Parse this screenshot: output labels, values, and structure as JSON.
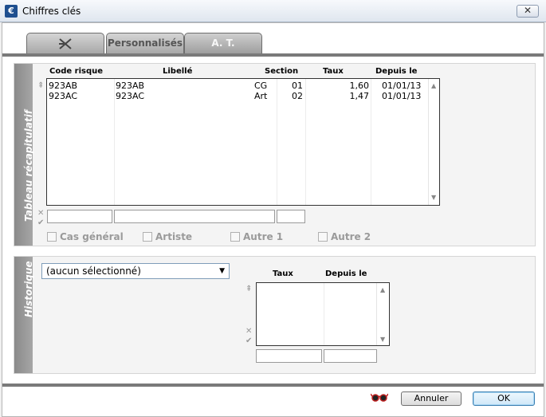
{
  "window": {
    "title": "Chiffres clés",
    "close_glyph": "✕",
    "app_icon_glyph": "€"
  },
  "tabs": [
    {
      "label": "",
      "icon": "cross-tools-icon"
    },
    {
      "label": "Personnalisés"
    },
    {
      "label": "A. T."
    }
  ],
  "summary": {
    "section_label": "Tableau récapitulatif",
    "headers": {
      "code": "Code risque",
      "libelle": "Libellé",
      "section": "Section",
      "taux": "Taux",
      "depuis": "Depuis le"
    },
    "rows": [
      {
        "code": "923AB",
        "libelle": "923AB",
        "section_a": "CG",
        "section_b": "01",
        "taux": "1,60",
        "depuis": "01/01/13"
      },
      {
        "code": "923AC",
        "libelle": "923AC",
        "section_a": "Art",
        "section_b": "02",
        "taux": "1,47",
        "depuis": "01/01/13"
      }
    ],
    "checkboxes": [
      "Cas général",
      "Artiste",
      "Autre 1",
      "Autre 2"
    ]
  },
  "history": {
    "section_label": "Historique",
    "select_value": "(aucun sélectionné)",
    "headers": {
      "taux": "Taux",
      "depuis": "Depuis le"
    }
  },
  "buttons": {
    "cancel": "Annuler",
    "ok": "OK"
  },
  "colors": {
    "accent": "#3c7fb1",
    "panel_strip": "#8a8a8a"
  }
}
